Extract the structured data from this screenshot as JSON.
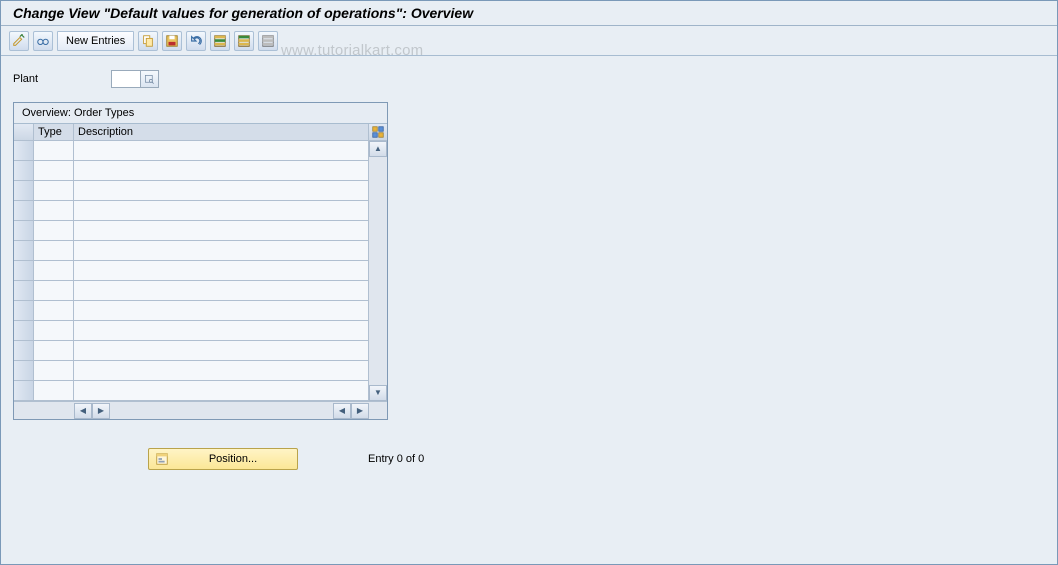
{
  "header": {
    "title": "Change View \"Default values for generation of operations\": Overview"
  },
  "toolbar": {
    "new_entries_label": "New Entries"
  },
  "icons": {
    "details": "details-icon",
    "glasses": "glasses-icon",
    "copy": "copy-icon",
    "save": "save-icon",
    "undo": "undo-icon",
    "select_all": "select-all-icon",
    "select_block": "select-block-icon",
    "deselect": "deselect-icon",
    "f4": "search-help-icon",
    "table_config": "table-config-icon",
    "position": "position-icon"
  },
  "fields": {
    "plant": {
      "label": "Plant",
      "value": ""
    }
  },
  "grid": {
    "title": "Overview: Order Types",
    "columns": {
      "type": "Type",
      "description": "Description"
    },
    "rows": [
      {
        "type": "",
        "description": ""
      },
      {
        "type": "",
        "description": ""
      },
      {
        "type": "",
        "description": ""
      },
      {
        "type": "",
        "description": ""
      },
      {
        "type": "",
        "description": ""
      },
      {
        "type": "",
        "description": ""
      },
      {
        "type": "",
        "description": ""
      },
      {
        "type": "",
        "description": ""
      },
      {
        "type": "",
        "description": ""
      },
      {
        "type": "",
        "description": ""
      },
      {
        "type": "",
        "description": ""
      },
      {
        "type": "",
        "description": ""
      },
      {
        "type": "",
        "description": ""
      }
    ]
  },
  "footer": {
    "position_label": "Position...",
    "entry_text": "Entry 0 of 0"
  },
  "watermark": "www.tutorialkart.com"
}
